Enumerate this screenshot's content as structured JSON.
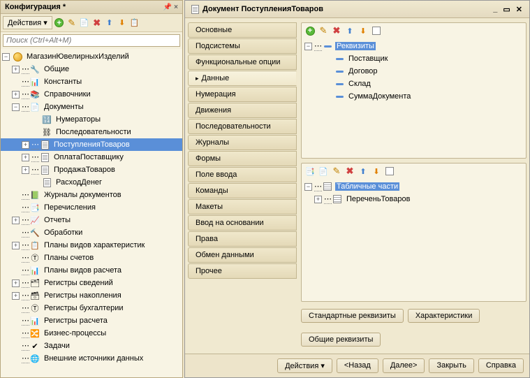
{
  "left": {
    "title": "Конфигурация *",
    "actions": "Действия",
    "search_placeholder": "Поиск (Ctrl+Alt+M)",
    "root": "МагазинЮвелирныхИзделий",
    "items": {
      "common": "Общие",
      "constants": "Константы",
      "catalogs": "Справочники",
      "documents": "Документы",
      "numerators": "Нумераторы",
      "sequences": "Последовательности",
      "doc1": "ПоступленияТоваров",
      "doc2": "ОплатаПоставщику",
      "doc3": "ПродажаТоваров",
      "doc4": "РасходДенег",
      "journals": "Журналы документов",
      "enums": "Перечисления",
      "reports": "Отчеты",
      "dataprocessors": "Обработки",
      "chartsChar": "Планы видов характеристик",
      "chartsAcc": "Планы счетов",
      "chartsCalc": "Планы видов расчета",
      "infoRegs": "Регистры сведений",
      "accumRegs": "Регистры накопления",
      "acctRegs": "Регистры бухгалтерии",
      "calcRegs": "Регистры расчета",
      "bp": "Бизнес-процессы",
      "tasks": "Задачи",
      "extsrc": "Внешние источники данных"
    }
  },
  "right": {
    "title": "Документ ПоступленияТоваров",
    "tabs": {
      "main": "Основные",
      "subsystems": "Подсистемы",
      "funcopts": "Функциональные опции",
      "data": "Данные",
      "numbering": "Нумерация",
      "movements": "Движения",
      "sequences": "Последовательности",
      "journals": "Журналы",
      "forms": "Формы",
      "input": "Поле ввода",
      "commands": "Команды",
      "templates": "Макеты",
      "basis": "Ввод на основании",
      "rights": "Права",
      "exchange": "Обмен данными",
      "other": "Прочее"
    },
    "attrs": {
      "group": "Реквизиты",
      "a1": "Поставщик",
      "a2": "Договор",
      "a3": "Склад",
      "a4": "СуммаДокумента"
    },
    "tabular": {
      "group": "Табличные части",
      "t1": "ПереченьТоваров"
    },
    "buttons": {
      "stdattrs": "Стандартные реквизиты",
      "charact": "Характеристики",
      "commonattrs": "Общие реквизиты",
      "actions": "Действия",
      "back": "<Назад",
      "next": "Далее>",
      "close": "Закрыть",
      "help": "Справка"
    }
  }
}
